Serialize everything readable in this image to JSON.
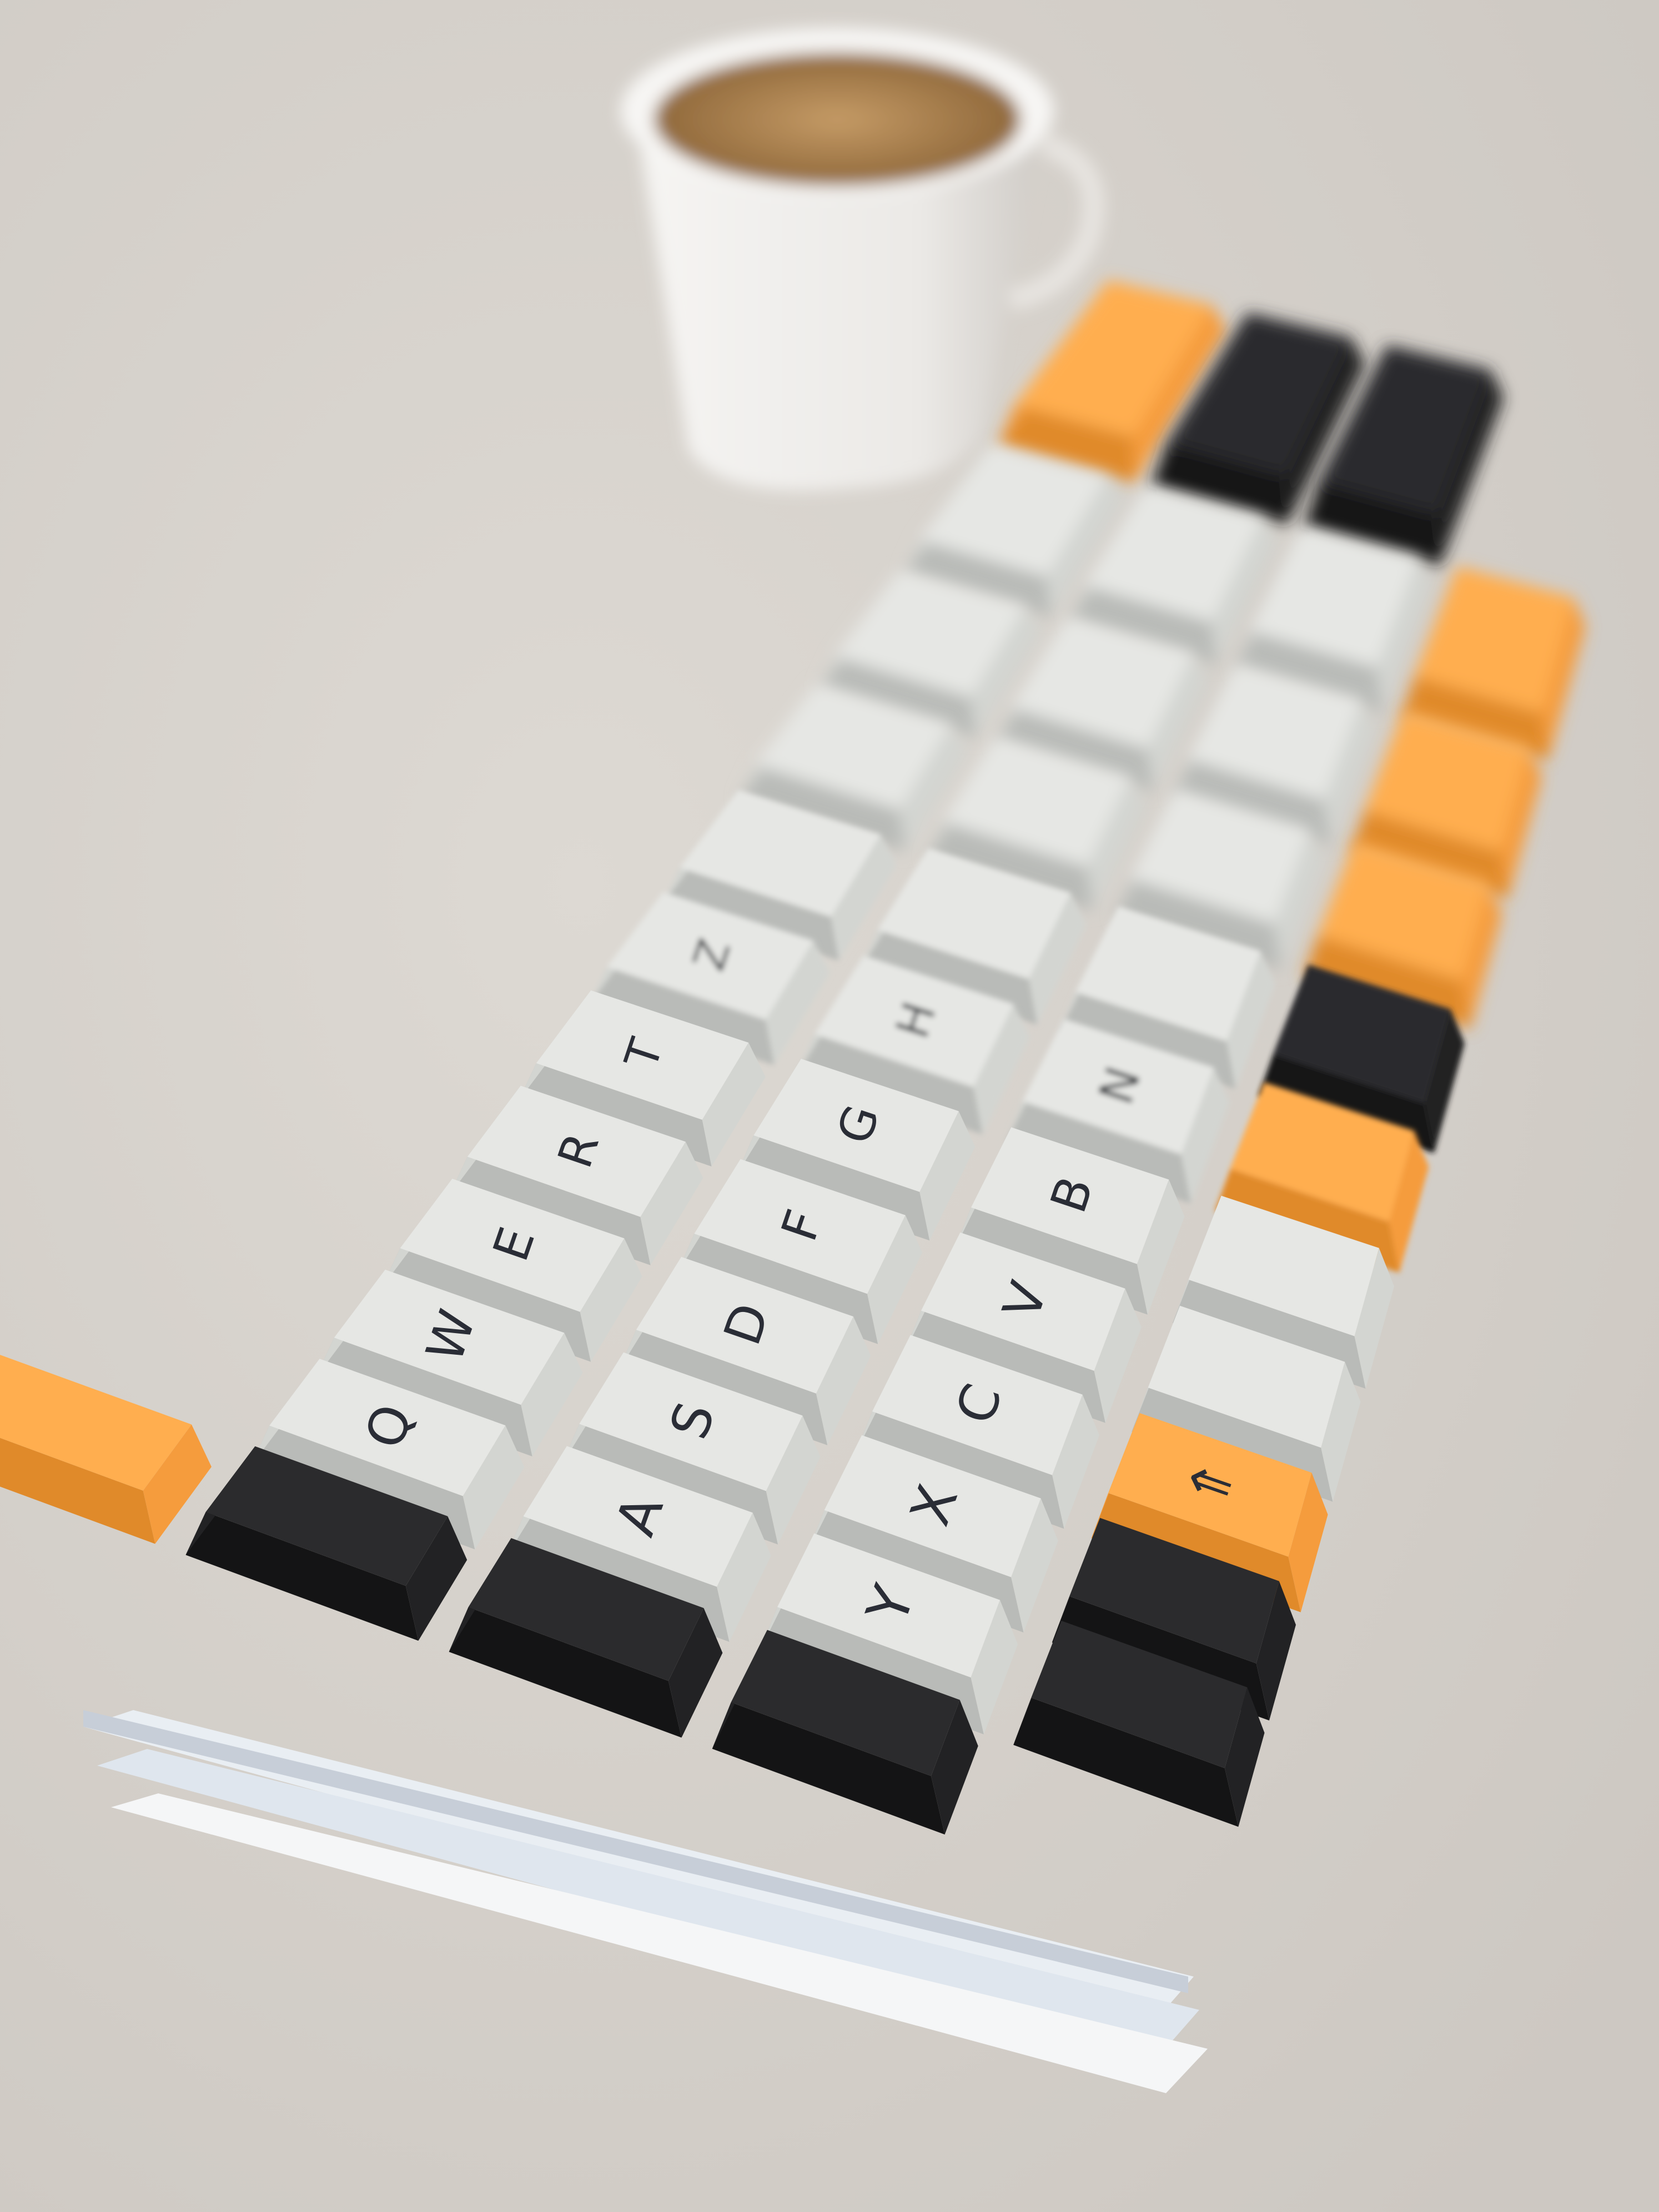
{
  "photo": {
    "subject": "ortholinear mechanical keyboard",
    "colors": {
      "desk": "#d9d5d0",
      "alpha_key": "#e6e7e4",
      "alpha_key_side": "#b9bbb8",
      "modifier_orange": "#ffae4f",
      "modifier_orange_side": "#e08a2a",
      "modifier_dark": "#2b2b2d",
      "modifier_dark_side": "#141415",
      "case": "#f2f4f6",
      "legend": "#2a2d36",
      "coffee": "#b78b55",
      "cup": "#f4f3f1"
    }
  },
  "keys": {
    "row_top_left": [
      "Q",
      "W",
      "E",
      "R",
      "T",
      "Z"
    ],
    "row_home": [
      "A",
      "S",
      "D",
      "F",
      "G",
      "H"
    ],
    "row_bottom": [
      "Y",
      "X",
      "C",
      "V",
      "B",
      "N"
    ],
    "shift_legend": "⇑"
  }
}
